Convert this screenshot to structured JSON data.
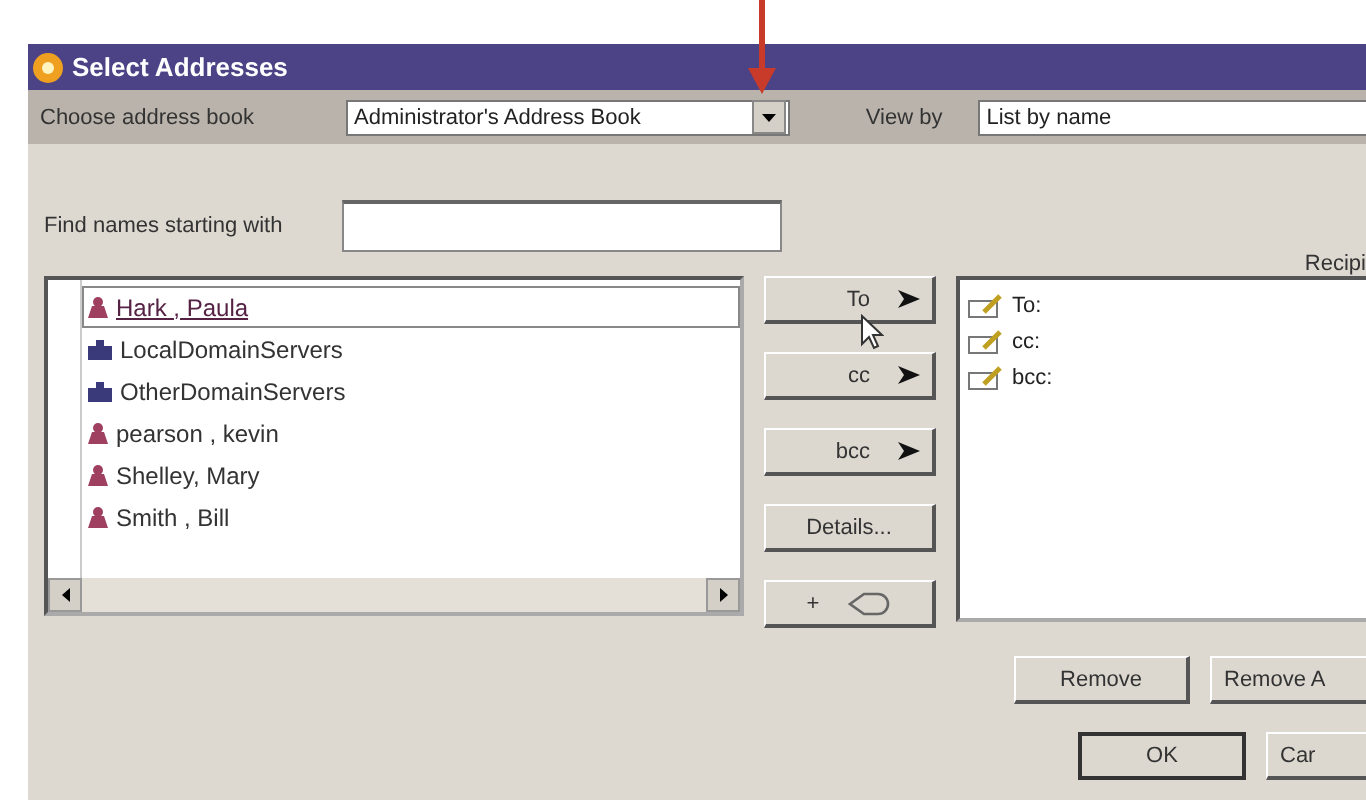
{
  "window": {
    "title": "Select Addresses"
  },
  "header": {
    "address_book_label": "Choose address book",
    "address_book_value": "Administrator's Address Book",
    "view_by_label": "View by",
    "view_by_value": "List by name"
  },
  "find": {
    "label": "Find names starting with"
  },
  "recipients_label": "Recipi",
  "names": [
    {
      "name": "Hark , Paula",
      "kind": "person",
      "selected": true
    },
    {
      "name": "LocalDomainServers",
      "kind": "group",
      "selected": false
    },
    {
      "name": "OtherDomainServers",
      "kind": "group",
      "selected": false
    },
    {
      "name": "pearson , kevin",
      "kind": "person",
      "selected": false
    },
    {
      "name": "Shelley, Mary",
      "kind": "person",
      "selected": false
    },
    {
      "name": "Smith , Bill",
      "kind": "person",
      "selected": false
    }
  ],
  "add_buttons": [
    {
      "label": "To",
      "kind": "arrow"
    },
    {
      "label": "cc",
      "kind": "arrow"
    },
    {
      "label": "bcc",
      "kind": "arrow"
    },
    {
      "label": "Details...",
      "kind": "plain"
    },
    {
      "label": "+",
      "kind": "link"
    }
  ],
  "recipients": [
    "To:",
    "cc:",
    "bcc:"
  ],
  "buttons": [
    {
      "label": "Remove"
    },
    {
      "label": "Remove A"
    }
  ],
  "dialog_buttons": [
    {
      "label": "OK"
    },
    {
      "label": "Car"
    }
  ]
}
